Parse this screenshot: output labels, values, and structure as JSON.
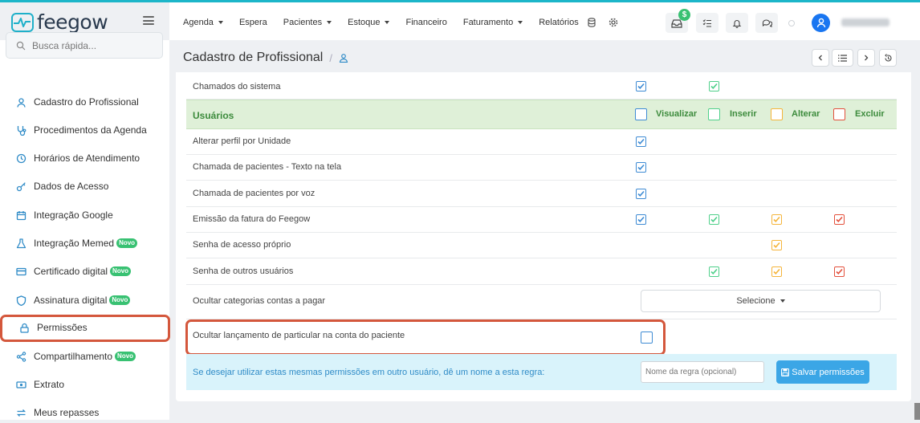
{
  "app": {
    "name": "feegow"
  },
  "topbar": {
    "menu": [
      {
        "label": "Agenda",
        "caret": true
      },
      {
        "label": "Espera",
        "caret": false
      },
      {
        "label": "Pacientes",
        "caret": true
      },
      {
        "label": "Estoque",
        "caret": true
      },
      {
        "label": "Financeiro",
        "caret": false
      },
      {
        "label": "Faturamento",
        "caret": true
      },
      {
        "label": "Relatórios",
        "caret": false
      }
    ],
    "notif_badge": "$"
  },
  "sidebar": {
    "search_placeholder": "Busca rápida...",
    "items": [
      {
        "label": "Cadastro do Profissional",
        "icon": "user-icon",
        "novo": false
      },
      {
        "label": "Procedimentos da Agenda",
        "icon": "stethoscope-icon",
        "novo": false
      },
      {
        "label": "Horários de Atendimento",
        "icon": "clock-icon",
        "novo": false
      },
      {
        "label": "Dados de Acesso",
        "icon": "key-icon",
        "novo": false
      },
      {
        "label": "Integração Google",
        "icon": "calendar-icon",
        "novo": false
      },
      {
        "label": "Integração Memed",
        "icon": "flask-icon",
        "novo": true
      },
      {
        "label": "Certificado digital",
        "icon": "card-icon",
        "novo": true
      },
      {
        "label": "Assinatura digital",
        "icon": "shield-icon",
        "novo": true
      },
      {
        "label": "Permissões",
        "icon": "lock-icon",
        "novo": false
      },
      {
        "label": "Compartilhamento",
        "icon": "share-icon",
        "novo": true
      },
      {
        "label": "Extrato",
        "icon": "money-icon",
        "novo": false
      },
      {
        "label": "Meus repasses",
        "icon": "transfer-icon",
        "novo": false
      }
    ],
    "novo_label": "Novo"
  },
  "header": {
    "title": "Cadastro de Profissional",
    "separator": "/"
  },
  "permissions": {
    "prev_row": {
      "label": "Chamados do sistema",
      "checks": {
        "visualizar": true,
        "inserir": true
      }
    },
    "group": {
      "title": "Usuários",
      "columns": [
        "Visualizar",
        "Inserir",
        "Alterar",
        "Excluir"
      ]
    },
    "rows": [
      {
        "label": "Alterar perfil por Unidade",
        "checks": {
          "visualizar": true
        }
      },
      {
        "label": "Chamada de pacientes - Texto na tela",
        "checks": {
          "visualizar": true
        }
      },
      {
        "label": "Chamada de pacientes por voz",
        "checks": {
          "visualizar": true
        }
      },
      {
        "label": "Emissão da fatura do Feegow",
        "checks": {
          "visualizar": true,
          "inserir": true,
          "alterar": true,
          "excluir": true
        }
      },
      {
        "label": "Senha de acesso próprio",
        "checks": {
          "alterar": true
        }
      },
      {
        "label": "Senha de outros usuários",
        "checks": {
          "inserir": true,
          "alterar": true,
          "excluir": true
        }
      }
    ],
    "select_row": {
      "label": "Ocultar categorias contas a pagar",
      "value": "Selecione"
    },
    "checkbox_row": {
      "label": "Ocultar lançamento de particular na conta do paciente",
      "checked": false
    },
    "save_row": {
      "text": "Se desejar utilizar estas mesmas permissões em outro usuário, dê um nome a esta regra:",
      "input_placeholder": "Nome da regra (opcional)",
      "button_label": "Salvar permissões"
    }
  },
  "colors": {
    "accent": "#1cb6c9",
    "visualizar": "#3e8bd4",
    "inserir": "#4fd08a",
    "alterar": "#f5b53b",
    "excluir": "#e3503c",
    "highlight": "#d4573c"
  }
}
